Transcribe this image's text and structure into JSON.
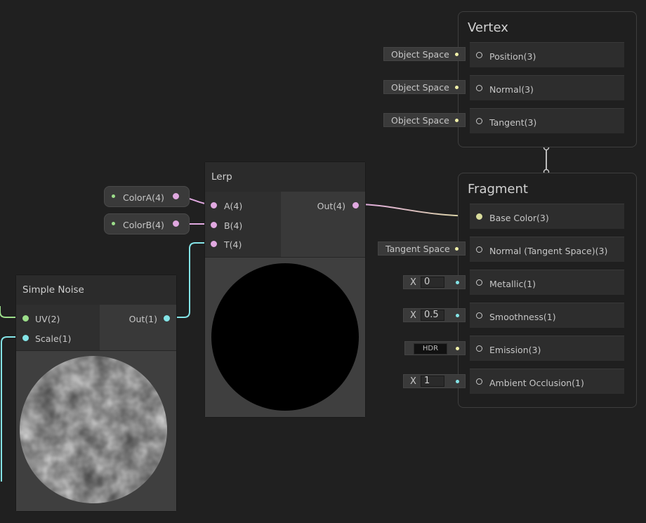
{
  "colors": {
    "background": "#202020",
    "wire_pink": "#e0a8e0",
    "wire_vec3": "#f0f0a8",
    "wire_vec1": "#84e4e7",
    "wire_vec2": "#9cde8a",
    "port_pink": "#e0a8e0",
    "port_vec3": "#f0f0a8",
    "port_vec1": "#84e4e7",
    "port_vec2": "#9cde8a"
  },
  "vertex": {
    "title": "Vertex",
    "slots": [
      {
        "label": "Position(3)",
        "pill": "Object Space"
      },
      {
        "label": "Normal(3)",
        "pill": "Object Space"
      },
      {
        "label": "Tangent(3)",
        "pill": "Object Space"
      }
    ]
  },
  "fragment": {
    "title": "Fragment",
    "slots": [
      {
        "label": "Base Color(3)"
      },
      {
        "label": "Normal (Tangent Space)(3)",
        "pill": "Tangent Space"
      },
      {
        "label": "Metallic(1)",
        "axis": "X",
        "value": "0"
      },
      {
        "label": "Smoothness(1)",
        "axis": "X",
        "value": "0.5"
      },
      {
        "label": "Emission(3)",
        "hdr": "HDR"
      },
      {
        "label": "Ambient Occlusion(1)",
        "axis": "X",
        "value": "1"
      }
    ]
  },
  "lerp": {
    "title": "Lerp",
    "inputs": [
      "A(4)",
      "B(4)",
      "T(4)"
    ],
    "output": "Out(4)"
  },
  "simple_noise": {
    "title": "Simple Noise",
    "inputs": [
      "UV(2)",
      "Scale(1)"
    ],
    "output": "Out(1)"
  },
  "properties": [
    {
      "label": "ColorA(4)"
    },
    {
      "label": "ColorB(4)"
    }
  ]
}
